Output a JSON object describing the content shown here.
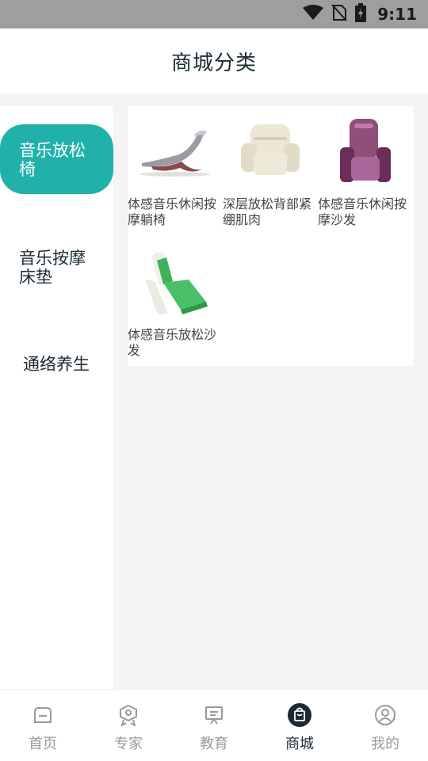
{
  "status_bar": {
    "time": "9:11",
    "icons": [
      "wifi-icon",
      "no-sim-icon",
      "battery-icon"
    ]
  },
  "header": {
    "title": "商城分类"
  },
  "categories": [
    {
      "label": "音乐放松椅",
      "active": true
    },
    {
      "label": "音乐按摩床垫",
      "active": false
    },
    {
      "label": "通络养生",
      "active": false
    }
  ],
  "products": [
    {
      "name": "体感音乐休闲按摩躺椅",
      "image": "lounge-chair-image"
    },
    {
      "name": "深层放松背部紧绷肌肉",
      "image": "recliner-image"
    },
    {
      "name": "体感音乐休闲按摩沙发",
      "image": "purple-sofa-image"
    },
    {
      "name": "体感音乐放松沙发",
      "image": "green-sofa-image"
    }
  ],
  "tabbar": {
    "items": [
      {
        "label": "首页",
        "icon": "home-icon",
        "active": false
      },
      {
        "label": "专家",
        "icon": "expert-badge-icon",
        "active": false
      },
      {
        "label": "教育",
        "icon": "education-board-icon",
        "active": false
      },
      {
        "label": "商城",
        "icon": "shop-bag-icon",
        "active": true
      },
      {
        "label": "我的",
        "icon": "profile-icon",
        "active": false
      }
    ]
  },
  "colors": {
    "accent": "#20b2aa",
    "text_dark": "#1b2b33",
    "tab_inactive": "#9a9a9a"
  }
}
